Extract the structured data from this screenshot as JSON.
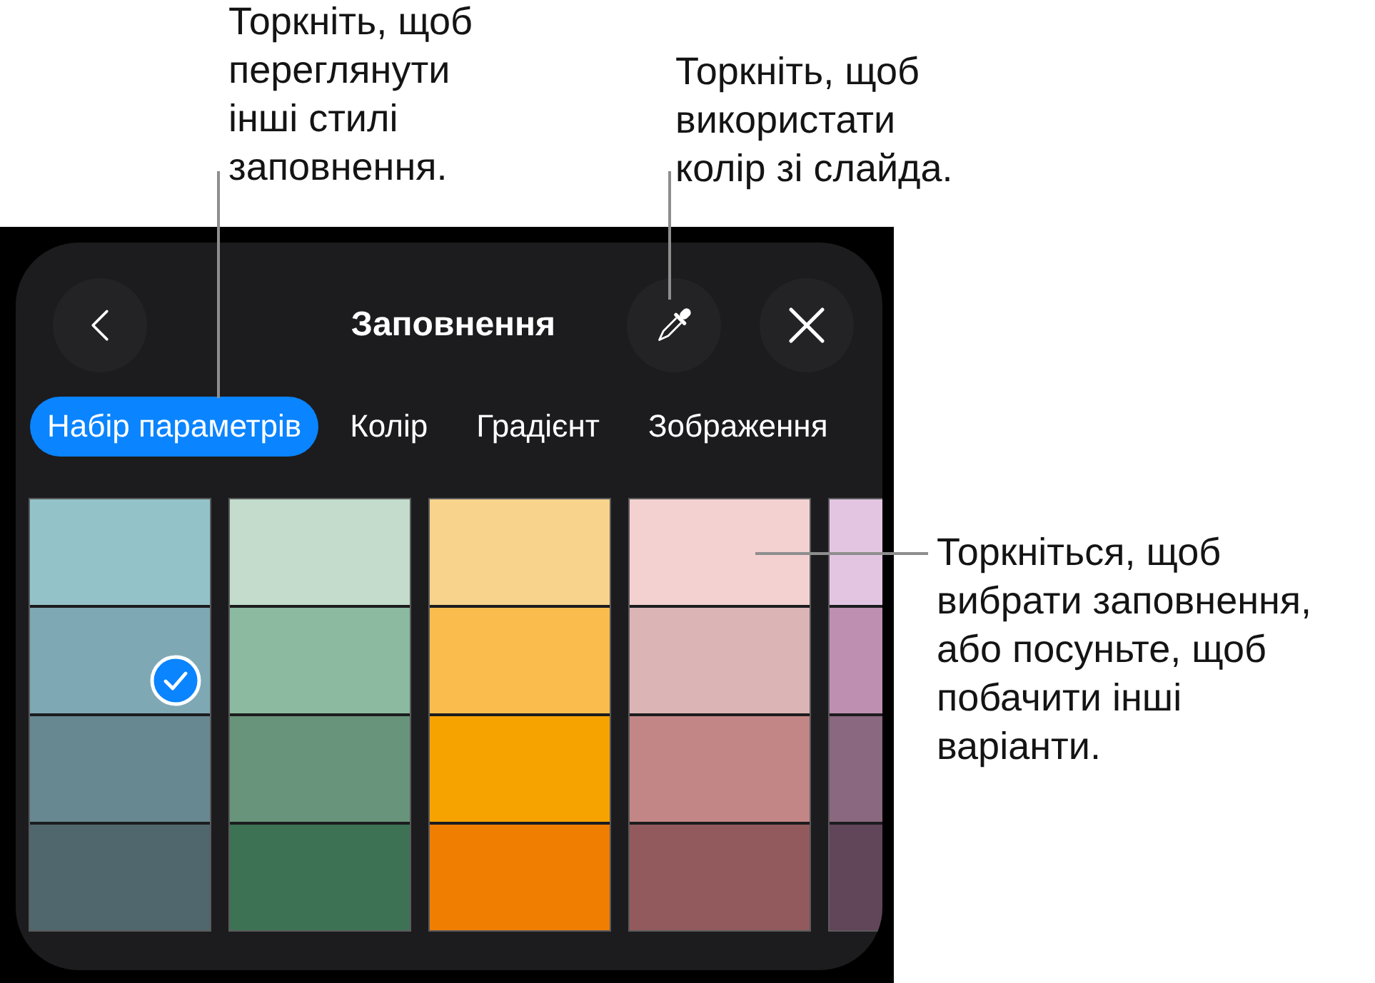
{
  "top_callouts": [
    {
      "text": "Торкніть, щоб переглянути інші стилі заповнення."
    },
    {
      "text": "Торкніть, щоб використати колір зі слайда."
    }
  ],
  "panel": {
    "title": "Заповнення",
    "tabs": [
      {
        "label": "Набір параметрів",
        "selected": true
      },
      {
        "label": "Колір",
        "selected": false
      },
      {
        "label": "Градієнт",
        "selected": false
      },
      {
        "label": "Зображення",
        "selected": false
      }
    ],
    "swatch_columns": [
      {
        "swatches": [
          {
            "color": "#93c3c8",
            "selected": false
          },
          {
            "color": "#7fa8b5",
            "selected": true
          },
          {
            "color": "#678891",
            "selected": false
          },
          {
            "color": "#4f676d",
            "selected": false
          }
        ]
      },
      {
        "swatches": [
          {
            "color": "#c3dccc",
            "selected": false
          },
          {
            "color": "#8bbaa0",
            "selected": false
          },
          {
            "color": "#68947b",
            "selected": false
          },
          {
            "color": "#3d7255",
            "selected": false
          }
        ]
      },
      {
        "swatches": [
          {
            "color": "#f7d38c",
            "selected": false
          },
          {
            "color": "#fabd4d",
            "selected": false
          },
          {
            "color": "#f6a300",
            "selected": false
          },
          {
            "color": "#f07e00",
            "selected": false
          }
        ]
      },
      {
        "swatches": [
          {
            "color": "#f3d1d0",
            "selected": false
          },
          {
            "color": "#dbb5b5",
            "selected": false
          },
          {
            "color": "#c38686",
            "selected": false
          },
          {
            "color": "#925a5c",
            "selected": false
          }
        ]
      },
      {
        "swatches": [
          {
            "color": "#e3c5e2",
            "selected": false
          },
          {
            "color": "#bf8fb2",
            "selected": false
          },
          {
            "color": "#8a687f",
            "selected": false
          },
          {
            "color": "#614559",
            "selected": false
          }
        ]
      }
    ]
  },
  "side_callout": {
    "text": "Торкніться, щоб вибрати заповнення, або посуньте, щоб побачити інші варіанти."
  }
}
